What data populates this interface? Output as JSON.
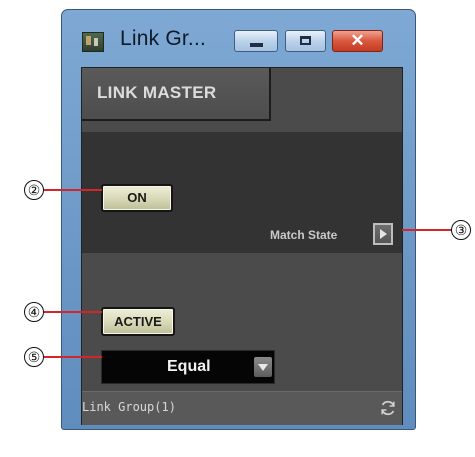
{
  "window": {
    "title": "Link Gr...",
    "buttons": {
      "minimize": "minimize",
      "maximize": "maximize",
      "close": "close"
    }
  },
  "tab": {
    "label": "LINK MASTER"
  },
  "controls": {
    "on_label": "ON",
    "match_state_label": "Match State",
    "active_label": "ACTIVE",
    "dropdown_value": "Equal"
  },
  "statusbar": {
    "text": "Link Group(1)"
  },
  "callouts": {
    "c2": "②",
    "c3": "③",
    "c4": "④",
    "c5": "⑤"
  },
  "colors": {
    "titlebar": "#6b97c6",
    "panel_bg": "#4b4b4b",
    "section_dark": "#333333",
    "button_face": "#d7d8b6",
    "close_button": "#d8583e",
    "callout_line": "#d3262a"
  }
}
